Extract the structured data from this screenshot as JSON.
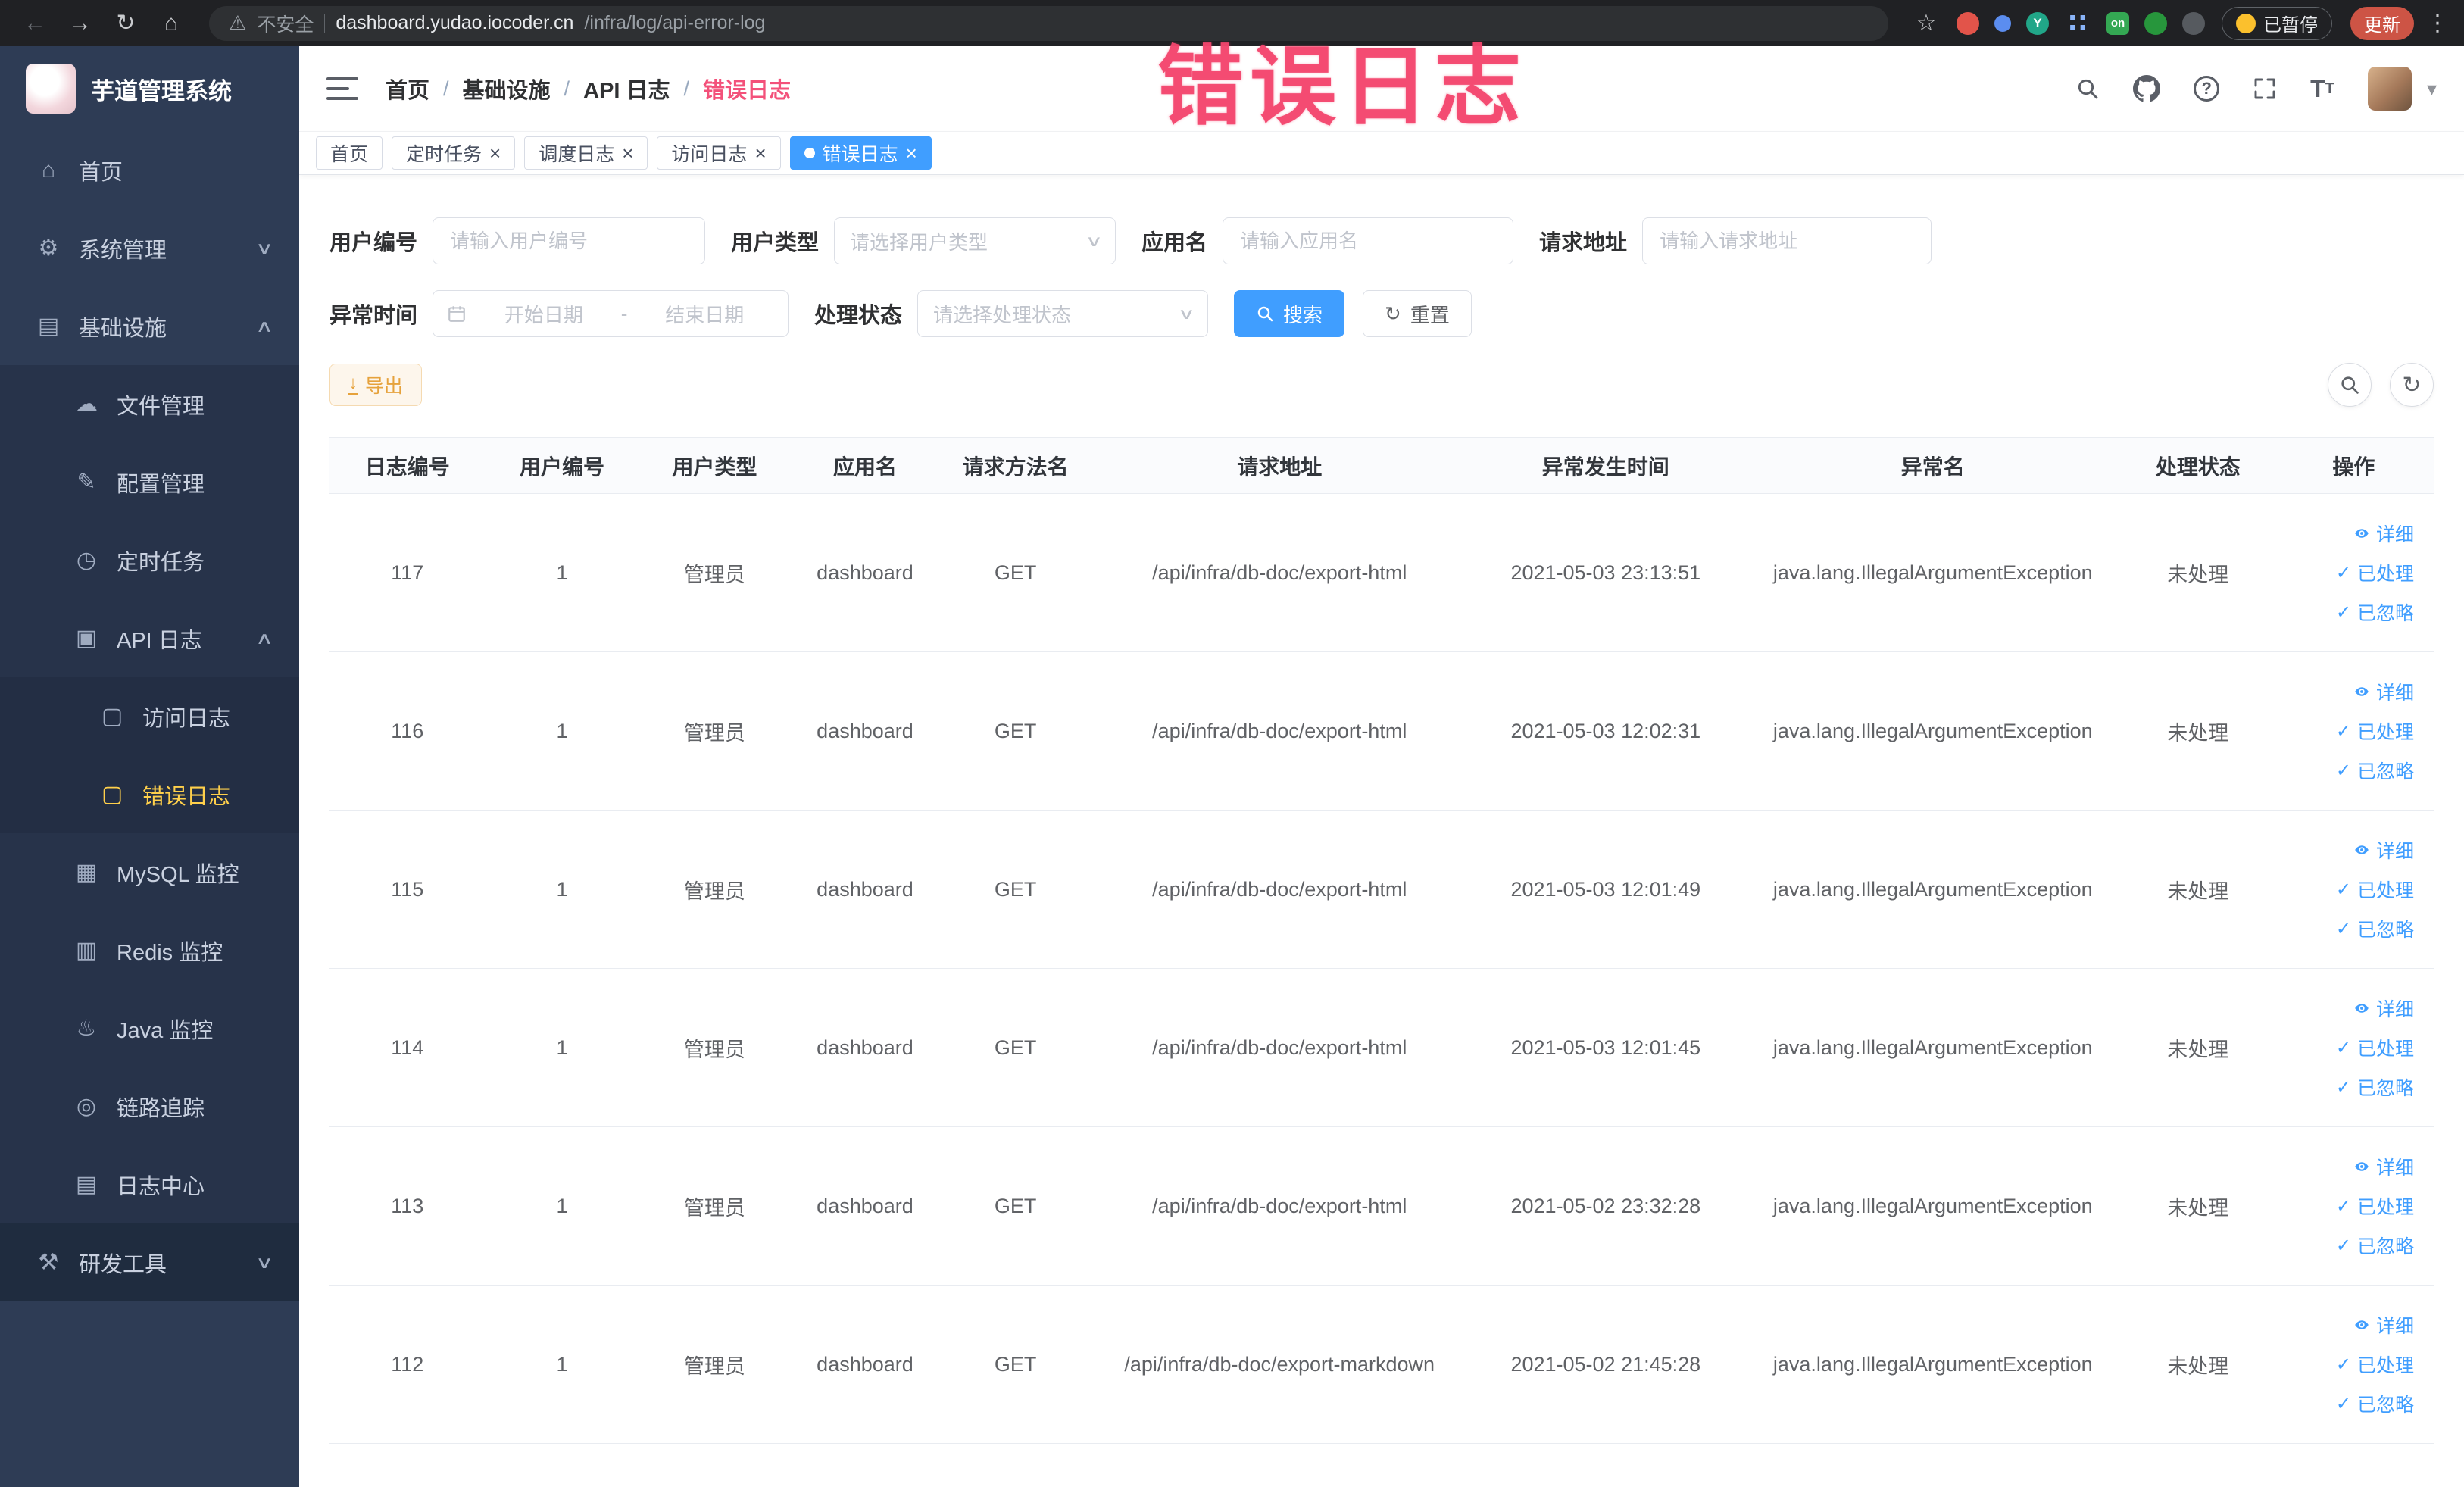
{
  "annotation": {
    "text": "错误日志"
  },
  "browser": {
    "security_label": "不安全",
    "url_host": "dashboard.yudao.iocoder.cn",
    "url_path": "/infra/log/api-error-log",
    "paused_label": "已暂停",
    "update_label": "更新"
  },
  "sidebar": {
    "logo_title": "芋道管理系统",
    "items": [
      {
        "name": "home",
        "label": "首页",
        "icon": "home",
        "level": 1
      },
      {
        "name": "system-management",
        "label": "系统管理",
        "icon": "gear",
        "level": 1,
        "arrow": "down"
      },
      {
        "name": "infrastructure",
        "label": "基础设施",
        "icon": "infra",
        "level": 1,
        "arrow": "up"
      },
      {
        "name": "file-management",
        "label": "文件管理",
        "icon": "cloud",
        "level": 2
      },
      {
        "name": "config-management",
        "label": "配置管理",
        "icon": "edit",
        "level": 2
      },
      {
        "name": "scheduled-tasks",
        "label": "定时任务",
        "icon": "timer",
        "level": 2
      },
      {
        "name": "api-logs",
        "label": "API 日志",
        "icon": "apilog",
        "level": 2,
        "arrow": "up"
      },
      {
        "name": "access-log",
        "label": "访问日志",
        "icon": "doc",
        "level": 3
      },
      {
        "name": "error-log",
        "label": "错误日志",
        "icon": "doc",
        "level": 3,
        "active": true
      },
      {
        "name": "mysql-monitor",
        "label": "MySQL 监控",
        "icon": "mysql",
        "level": 2
      },
      {
        "name": "redis-monitor",
        "label": "Redis 监控",
        "icon": "redis",
        "level": 2
      },
      {
        "name": "java-monitor",
        "label": "Java 监控",
        "icon": "java",
        "level": 2
      },
      {
        "name": "trace",
        "label": "链路追踪",
        "icon": "trace",
        "level": 2
      },
      {
        "name": "log-center",
        "label": "日志中心",
        "icon": "logcenter",
        "level": 2
      },
      {
        "name": "dev-tools",
        "label": "研发工具",
        "icon": "tools",
        "level": 1,
        "arrow": "down",
        "dark": true
      }
    ]
  },
  "header": {
    "breadcrumb": [
      "首页",
      "基础设施",
      "API 日志",
      "错误日志"
    ]
  },
  "tabs": [
    {
      "name": "home",
      "label": "首页",
      "closable": false,
      "active": false
    },
    {
      "name": "scheduled-tasks",
      "label": "定时任务",
      "closable": true,
      "active": false
    },
    {
      "name": "job-log",
      "label": "调度日志",
      "closable": true,
      "active": false
    },
    {
      "name": "access-log",
      "label": "访问日志",
      "closable": true,
      "active": false
    },
    {
      "name": "error-log",
      "label": "错误日志",
      "closable": true,
      "active": true
    }
  ],
  "filters": {
    "user_id": {
      "label": "用户编号",
      "placeholder": "请输入用户编号"
    },
    "user_type": {
      "label": "用户类型",
      "placeholder": "请选择用户类型"
    },
    "app_name": {
      "label": "应用名",
      "placeholder": "请输入应用名"
    },
    "request_url": {
      "label": "请求地址",
      "placeholder": "请输入请求地址"
    },
    "error_time": {
      "label": "异常时间",
      "start_placeholder": "开始日期",
      "separator": "-",
      "end_placeholder": "结束日期"
    },
    "process_status": {
      "label": "处理状态",
      "placeholder": "请选择处理状态"
    },
    "search_label": "搜索",
    "reset_label": "重置"
  },
  "toolbar": {
    "export_label": "导出"
  },
  "table": {
    "columns": [
      "日志编号",
      "用户编号",
      "用户类型",
      "应用名",
      "请求方法名",
      "请求地址",
      "异常发生时间",
      "异常名",
      "处理状态",
      "操作"
    ],
    "row_actions": [
      {
        "name": "detail",
        "label": "详细",
        "icon": "eye"
      },
      {
        "name": "processed",
        "label": "已处理",
        "icon": "check"
      },
      {
        "name": "ignored",
        "label": "已忽略",
        "icon": "check"
      }
    ],
    "rows": [
      {
        "id": "117",
        "user_id": "1",
        "user_type": "管理员",
        "app_name": "dashboard",
        "method": "GET",
        "url": "/api/infra/db-doc/export-html",
        "time": "2021-05-03 23:13:51",
        "exception": "java.lang.IllegalArgumentException",
        "status": "未处理"
      },
      {
        "id": "116",
        "user_id": "1",
        "user_type": "管理员",
        "app_name": "dashboard",
        "method": "GET",
        "url": "/api/infra/db-doc/export-html",
        "time": "2021-05-03 12:02:31",
        "exception": "java.lang.IllegalArgumentException",
        "status": "未处理"
      },
      {
        "id": "115",
        "user_id": "1",
        "user_type": "管理员",
        "app_name": "dashboard",
        "method": "GET",
        "url": "/api/infra/db-doc/export-html",
        "time": "2021-05-03 12:01:49",
        "exception": "java.lang.IllegalArgumentException",
        "status": "未处理"
      },
      {
        "id": "114",
        "user_id": "1",
        "user_type": "管理员",
        "app_name": "dashboard",
        "method": "GET",
        "url": "/api/infra/db-doc/export-html",
        "time": "2021-05-03 12:01:45",
        "exception": "java.lang.IllegalArgumentException",
        "status": "未处理"
      },
      {
        "id": "113",
        "user_id": "1",
        "user_type": "管理员",
        "app_name": "dashboard",
        "method": "GET",
        "url": "/api/infra/db-doc/export-html",
        "time": "2021-05-02 23:32:28",
        "exception": "java.lang.IllegalArgumentException",
        "status": "未处理"
      },
      {
        "id": "112",
        "user_id": "1",
        "user_type": "管理员",
        "app_name": "dashboard",
        "method": "GET",
        "url": "/api/infra/db-doc/export-markdown",
        "time": "2021-05-02 21:45:28",
        "exception": "java.lang.IllegalArgumentException",
        "status": "未处理"
      }
    ]
  },
  "colors": {
    "primary": "#409eff",
    "sidebar_active": "#ffd04b",
    "warning_button": "#e6a23c",
    "annotation": "#f3466e"
  }
}
